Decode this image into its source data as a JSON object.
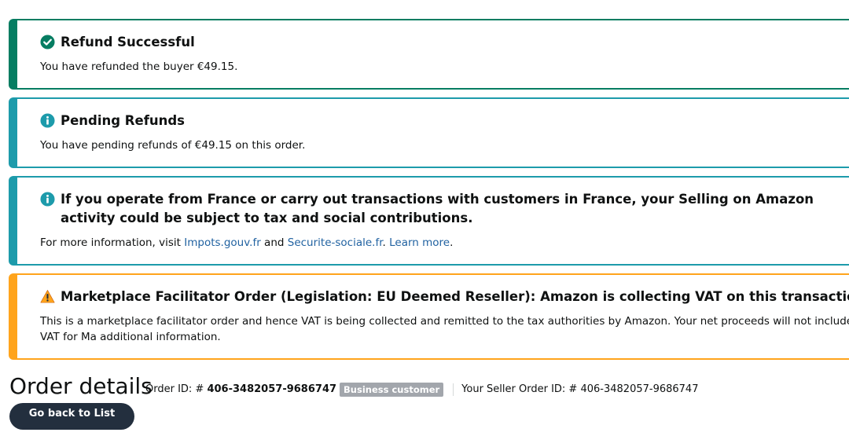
{
  "alerts": {
    "success": {
      "icon": "check-circle-icon",
      "title": "Refund Successful",
      "body": "You have refunded the buyer €49.15."
    },
    "pending": {
      "icon": "info-icon",
      "title": "Pending Refunds",
      "body": "You have pending refunds of €49.15 on this order."
    },
    "france": {
      "icon": "info-icon",
      "title": "If you operate from France or carry out transactions with customers in France, your Selling on Amazon activity could be subject to tax and social contributions.",
      "body_prefix": "For more information, visit ",
      "link1": "Impots.gouv.fr",
      "and": " and ",
      "link2": "Securite-sociale.fr",
      "dot": ". ",
      "learn_more": "Learn more",
      "end": "."
    },
    "marketplace": {
      "icon": "warning-icon",
      "title": "Marketplace Facilitator Order (Legislation: EU Deemed Reseller): Amazon is collecting VAT on this transaction.",
      "body": "This is a marketplace facilitator order and hence VAT is being collected and remitted to the tax authorities by Amazon. Your net proceeds will not include VAT for Ma additional information."
    }
  },
  "order": {
    "title": "Order details",
    "order_id_label": "Order ID: # ",
    "order_id": "406-3482057-9686747",
    "badge": "Business customer",
    "seller_order_label": "Your Seller Order ID: # ",
    "seller_order_id": "406-3482057-9686747",
    "back_button": "Go back to List Orders"
  },
  "colors": {
    "success": "#067d62",
    "info": "#1d9bab",
    "warning": "#ffa41c",
    "link": "#2162a1"
  }
}
